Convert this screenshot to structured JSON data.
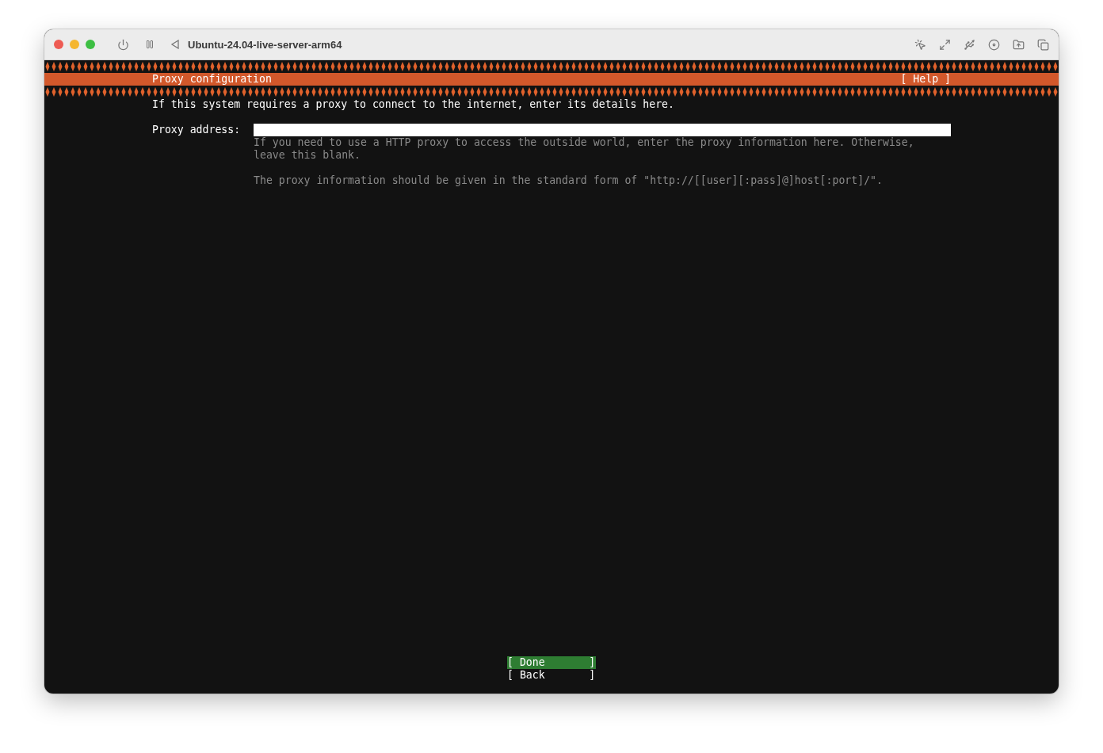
{
  "window": {
    "title": "Ubuntu-24.04-live-server-arm64"
  },
  "header": {
    "title": "Proxy configuration",
    "help": "[ Help ]"
  },
  "intro": "If this system requires a proxy to connect to the internet, enter its details here.",
  "proxy_field": {
    "label": "Proxy address:",
    "focused": true
  },
  "help_text": [
    "If you need to use a HTTP proxy to access the outside world, enter the proxy information here. Otherwise, leave this blank.",
    "The proxy information should be given in the standard form of \"http://[[user][:pass]@]host[:port]/\"."
  ],
  "buttons": [
    {
      "label": "[ Done       ]",
      "selected": true
    },
    {
      "label": "[ Back       ]",
      "selected": false
    }
  ]
}
